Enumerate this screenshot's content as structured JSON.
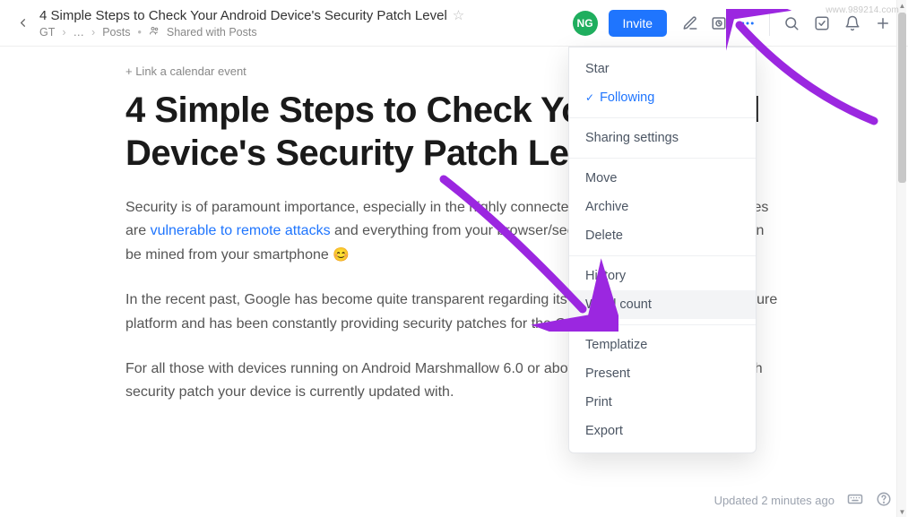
{
  "header": {
    "doc_title": "4 Simple Steps to Check Your Android Device's Security Patch Level",
    "breadcrumb": {
      "root": "GT",
      "mid": "…",
      "posts": "Posts",
      "shared": "Shared with Posts"
    },
    "avatar_initials": "NG",
    "invite_label": "Invite"
  },
  "content": {
    "calendar_link": "+ Link a calendar event",
    "heading": "4  Simple Steps to Check Your Android Device's Security Patch Level",
    "para1_a": "Security is of paramount importance, especially in the highly connected world of today, where devices are ",
    "para1_link": "vulnerable to remote attacks",
    "para1_b": " and everything from your browser/sec history credit card details can be mined from your smartphone ",
    "para2": "In the recent past, Google has become quite transparent regarding its efforts to make Android a secure platform and has been constantly providing security patches for the OS.",
    "para3": "For all those with devices running on Android Marshmallow 6.0 or above, here is how to check which security patch your device is currently updated with."
  },
  "dropdown": {
    "star": "Star",
    "following": "Following",
    "sharing": "Sharing settings",
    "move": "Move",
    "archive": "Archive",
    "delete": "Delete",
    "history": "History",
    "word_count": "Word count",
    "templatize": "Templatize",
    "present": "Present",
    "print": "Print",
    "export": "Export"
  },
  "footer": {
    "updated": "Updated 2 minutes ago"
  },
  "watermark": "www.989214.com"
}
